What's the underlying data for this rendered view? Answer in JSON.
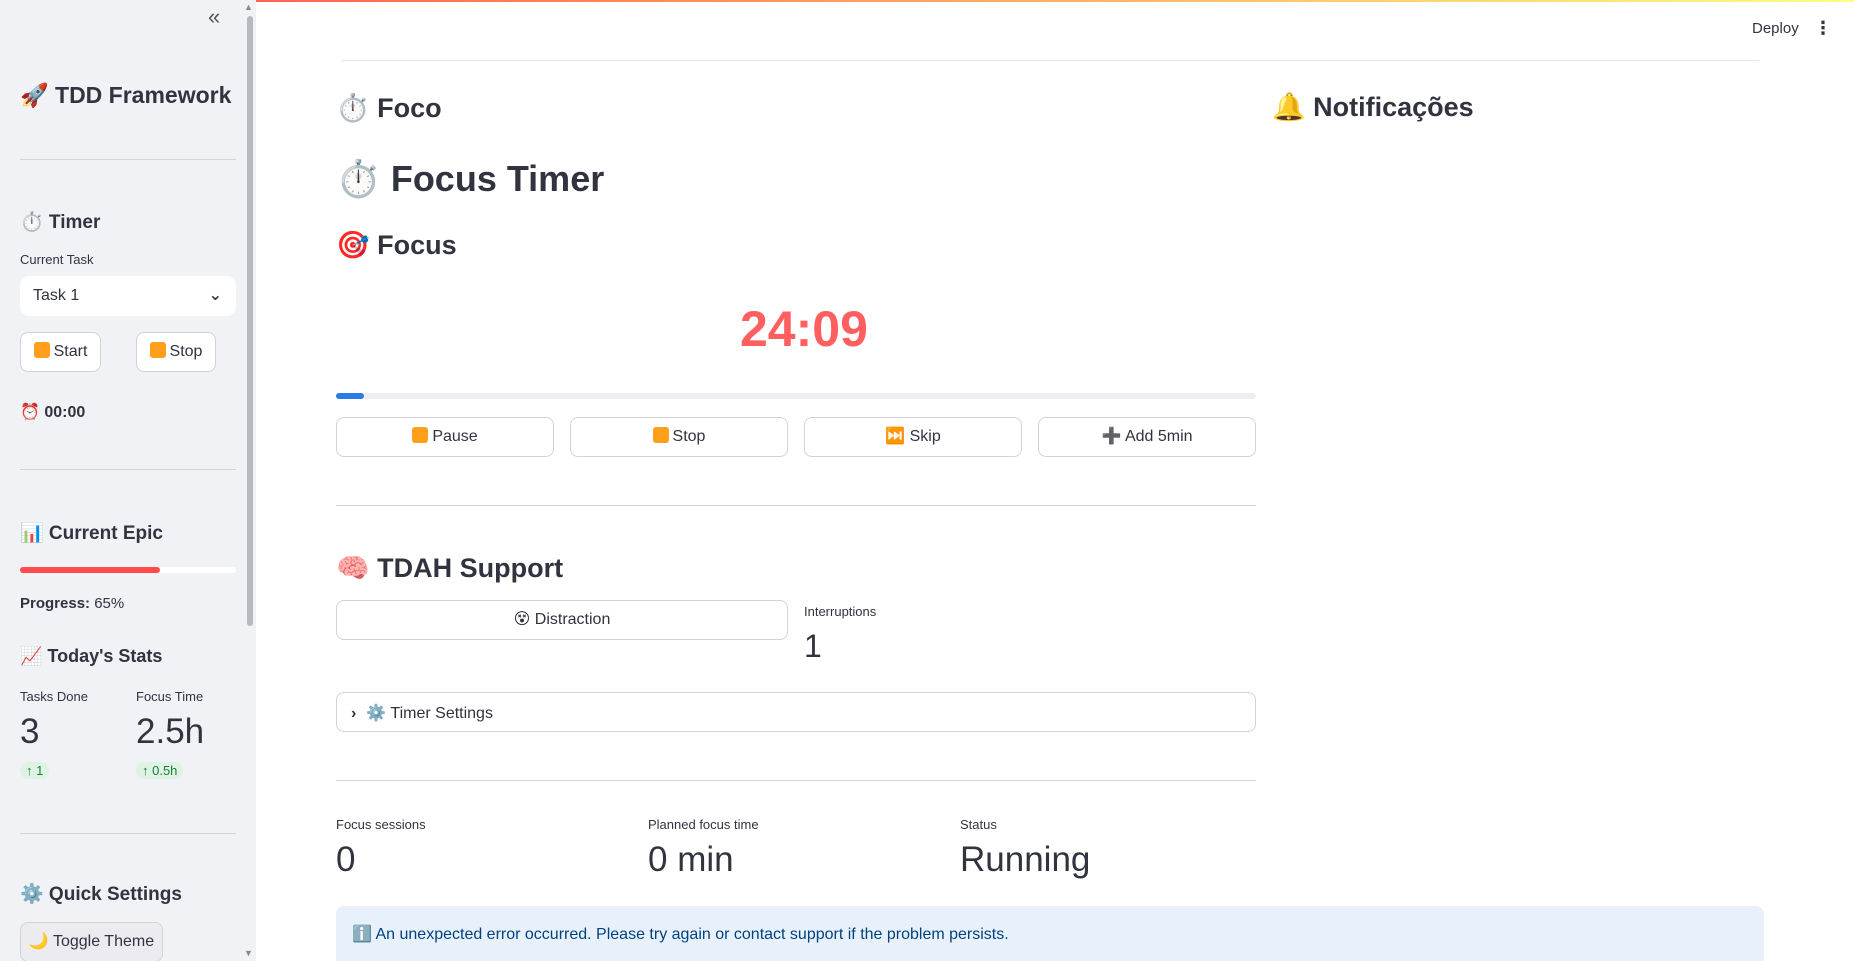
{
  "sidebar": {
    "collapse_icon": "«",
    "title": "🚀 TDD Framework",
    "timer_heading": "⏱️ Timer",
    "current_task_label": "Current Task",
    "current_task_value": "Task 1",
    "start_label": "Start",
    "stop_label": "Stop",
    "timer_readout": "⏰ 00:00",
    "epic_heading": "📊 Current Epic",
    "epic_progress": 0.65,
    "progress_label": "Progress:",
    "progress_value": "65%",
    "stats_heading": "📈 Today's Stats",
    "tasks_done_label": "Tasks Done",
    "tasks_done_value": "3",
    "tasks_done_delta": "↑ 1",
    "focus_time_label": "Focus Time",
    "focus_time_value": "2.5h",
    "focus_time_delta": "↑ 0.5h",
    "quick_settings_heading": "⚙️ Quick Settings",
    "toggle_theme_label": "🌙 Toggle Theme"
  },
  "header": {
    "deploy_label": "Deploy",
    "menu_icon": "⋮"
  },
  "main": {
    "foco_heading": "⏱️ Foco",
    "focus_timer_title": "⏱️ Focus Timer",
    "focus_heading": "🎯 Focus",
    "timer_value": "24:09",
    "timer_progress": 0.03,
    "pause_label": "Pause",
    "stop_label": "Stop",
    "skip_label": "⏭️ Skip",
    "add_label": "➕ Add 5min",
    "tdah_heading": "🧠 TDAH Support",
    "distraction_label": "😵 Distraction",
    "interruptions_label": "Interruptions",
    "interruptions_value": "1",
    "timer_settings_label": "⚙️ Timer Settings",
    "focus_sessions_label": "Focus sessions",
    "focus_sessions_value": "0",
    "planned_focus_label": "Planned focus time",
    "planned_focus_value": "0 min",
    "status_label": "Status",
    "status_value": "Running",
    "info_message": "ℹ️ An unexpected error occurred. Please try again or contact support if the problem persists.",
    "notifications_heading": "🔔 Notificações"
  },
  "colors": {
    "accent_red": "#ff4b4b",
    "timer_red": "#ff5f5f",
    "progress_blue": "#2c7be5",
    "info_bg": "#e8f1fb"
  }
}
